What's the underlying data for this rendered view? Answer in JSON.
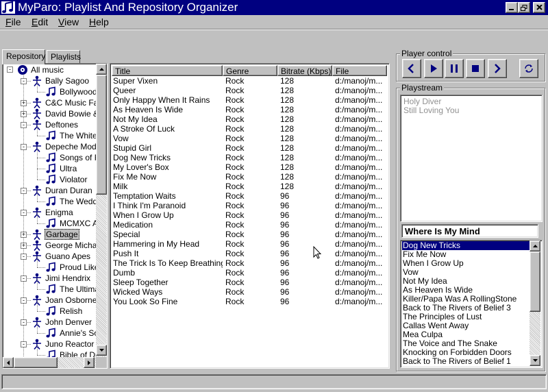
{
  "window": {
    "title": "MyParo: Playlist And Repository Organizer"
  },
  "menu": [
    {
      "label": "File",
      "mnemonic": "F",
      "rest": "ile"
    },
    {
      "label": "Edit",
      "mnemonic": "E",
      "rest": "dit"
    },
    {
      "label": "View",
      "mnemonic": "V",
      "rest": "iew"
    },
    {
      "label": "Help",
      "mnemonic": "H",
      "rest": "elp"
    }
  ],
  "tabs": {
    "repository": "Repository",
    "playlists": "Playlists"
  },
  "tree": {
    "root": "All music",
    "nodes": [
      {
        "label": "Bally Sagoo",
        "type": "artist",
        "expander": "-"
      },
      {
        "label": "Bollywood F",
        "type": "album"
      },
      {
        "label": "C&C Music Fac",
        "type": "artist",
        "expander": "+"
      },
      {
        "label": "David Bowie &",
        "type": "artist",
        "expander": "+"
      },
      {
        "label": "Deftones",
        "type": "artist",
        "expander": "-"
      },
      {
        "label": "The White",
        "type": "album"
      },
      {
        "label": "Depeche Mode",
        "type": "artist",
        "expander": "-"
      },
      {
        "label": "Songs of Fa",
        "type": "album"
      },
      {
        "label": "Ultra",
        "type": "album"
      },
      {
        "label": "Violator",
        "type": "album"
      },
      {
        "label": "Duran Duran",
        "type": "artist",
        "expander": "-"
      },
      {
        "label": "The Weddi",
        "type": "album"
      },
      {
        "label": "Enigma",
        "type": "artist",
        "expander": "-"
      },
      {
        "label": "MCMXC AD",
        "type": "album"
      },
      {
        "label": "Garbage",
        "type": "artist",
        "expander": "+",
        "selected": true
      },
      {
        "label": "George Michae",
        "type": "artist",
        "expander": "+"
      },
      {
        "label": "Guano Apes",
        "type": "artist",
        "expander": "-"
      },
      {
        "label": "Proud Like",
        "type": "album"
      },
      {
        "label": "Jimi Hendrix",
        "type": "artist",
        "expander": "-"
      },
      {
        "label": "The Ultimat",
        "type": "album"
      },
      {
        "label": "Joan Osborne",
        "type": "artist",
        "expander": "-"
      },
      {
        "label": "Relish",
        "type": "album"
      },
      {
        "label": "John Denver",
        "type": "artist",
        "expander": "-"
      },
      {
        "label": "Annie's Sor",
        "type": "album"
      },
      {
        "label": "Juno Reactor",
        "type": "artist",
        "expander": "-"
      },
      {
        "label": "Bible of Dre",
        "type": "album"
      }
    ]
  },
  "songs": {
    "columns": [
      "Title",
      "Genre",
      "Bitrate (Kbps)",
      "File"
    ],
    "rows": [
      [
        "Super Vixen",
        "Rock",
        "128",
        "d:/manoj/m..."
      ],
      [
        "Queer",
        "Rock",
        "128",
        "d:/manoj/m..."
      ],
      [
        "Only Happy When It Rains",
        "Rock",
        "128",
        "d:/manoj/m..."
      ],
      [
        "As Heaven Is Wide",
        "Rock",
        "128",
        "d:/manoj/m..."
      ],
      [
        "Not My Idea",
        "Rock",
        "128",
        "d:/manoj/m..."
      ],
      [
        "A Stroke Of Luck",
        "Rock",
        "128",
        "d:/manoj/m..."
      ],
      [
        "Vow",
        "Rock",
        "128",
        "d:/manoj/m..."
      ],
      [
        "Stupid Girl",
        "Rock",
        "128",
        "d:/manoj/m..."
      ],
      [
        "Dog New Tricks",
        "Rock",
        "128",
        "d:/manoj/m..."
      ],
      [
        "My Lover's Box",
        "Rock",
        "128",
        "d:/manoj/m..."
      ],
      [
        "Fix Me Now",
        "Rock",
        "128",
        "d:/manoj/m..."
      ],
      [
        "Milk",
        "Rock",
        "128",
        "d:/manoj/m..."
      ],
      [
        "Temptation Waits",
        "Rock",
        "96",
        "d:/manoj/m..."
      ],
      [
        "I Think I'm Paranoid",
        "Rock",
        "96",
        "d:/manoj/m..."
      ],
      [
        "When I Grow Up",
        "Rock",
        "96",
        "d:/manoj/m..."
      ],
      [
        "Medication",
        "Rock",
        "96",
        "d:/manoj/m..."
      ],
      [
        "Special",
        "Rock",
        "96",
        "d:/manoj/m..."
      ],
      [
        "Hammering in My Head",
        "Rock",
        "96",
        "d:/manoj/m..."
      ],
      [
        "Push It",
        "Rock",
        "96",
        "d:/manoj/m..."
      ],
      [
        "The Trick Is To Keep Breathing",
        "Rock",
        "96",
        "d:/manoj/m..."
      ],
      [
        "Dumb",
        "Rock",
        "96",
        "d:/manoj/m..."
      ],
      [
        "Sleep Together",
        "Rock",
        "96",
        "d:/manoj/m..."
      ],
      [
        "Wicked Ways",
        "Rock",
        "96",
        "d:/manoj/m..."
      ],
      [
        "You Look So Fine",
        "Rock",
        "96",
        "d:/manoj/m..."
      ]
    ]
  },
  "player_control": {
    "label": "Player control",
    "buttons": [
      {
        "name": "previous-button",
        "icon": "chevron-left-icon"
      },
      {
        "name": "play-button",
        "icon": "play-icon"
      },
      {
        "name": "pause-button",
        "icon": "pause-icon"
      },
      {
        "name": "stop-button",
        "icon": "stop-icon"
      },
      {
        "name": "next-button",
        "icon": "chevron-right-icon"
      },
      {
        "name": "repeat-button",
        "icon": "repeat-icon"
      }
    ]
  },
  "playstream": {
    "label": "Playstream",
    "items": [
      "Holy Diver",
      "Still Loving You"
    ],
    "current": "Where Is My Mind",
    "queue": [
      "Dog New Tricks",
      "Fix Me Now",
      "When I Grow Up",
      "Vow",
      "Not My Idea",
      "As Heaven Is Wide",
      "Killer/Papa Was A RollingStone",
      "Back to The Rivers of Belief 3",
      "The Principles of Lust",
      "Callas Went Away",
      "Mea Culpa",
      "The Voice and The Snake",
      "Knocking on Forbidden Doors",
      "Back to The Rivers of Belief 1"
    ],
    "selected_index": 0
  },
  "colors": {
    "titlebar": "#000080",
    "face": "#c0c0c0",
    "selection": "#000080",
    "icon_blue": "#000080",
    "faded_text": "#909090"
  }
}
